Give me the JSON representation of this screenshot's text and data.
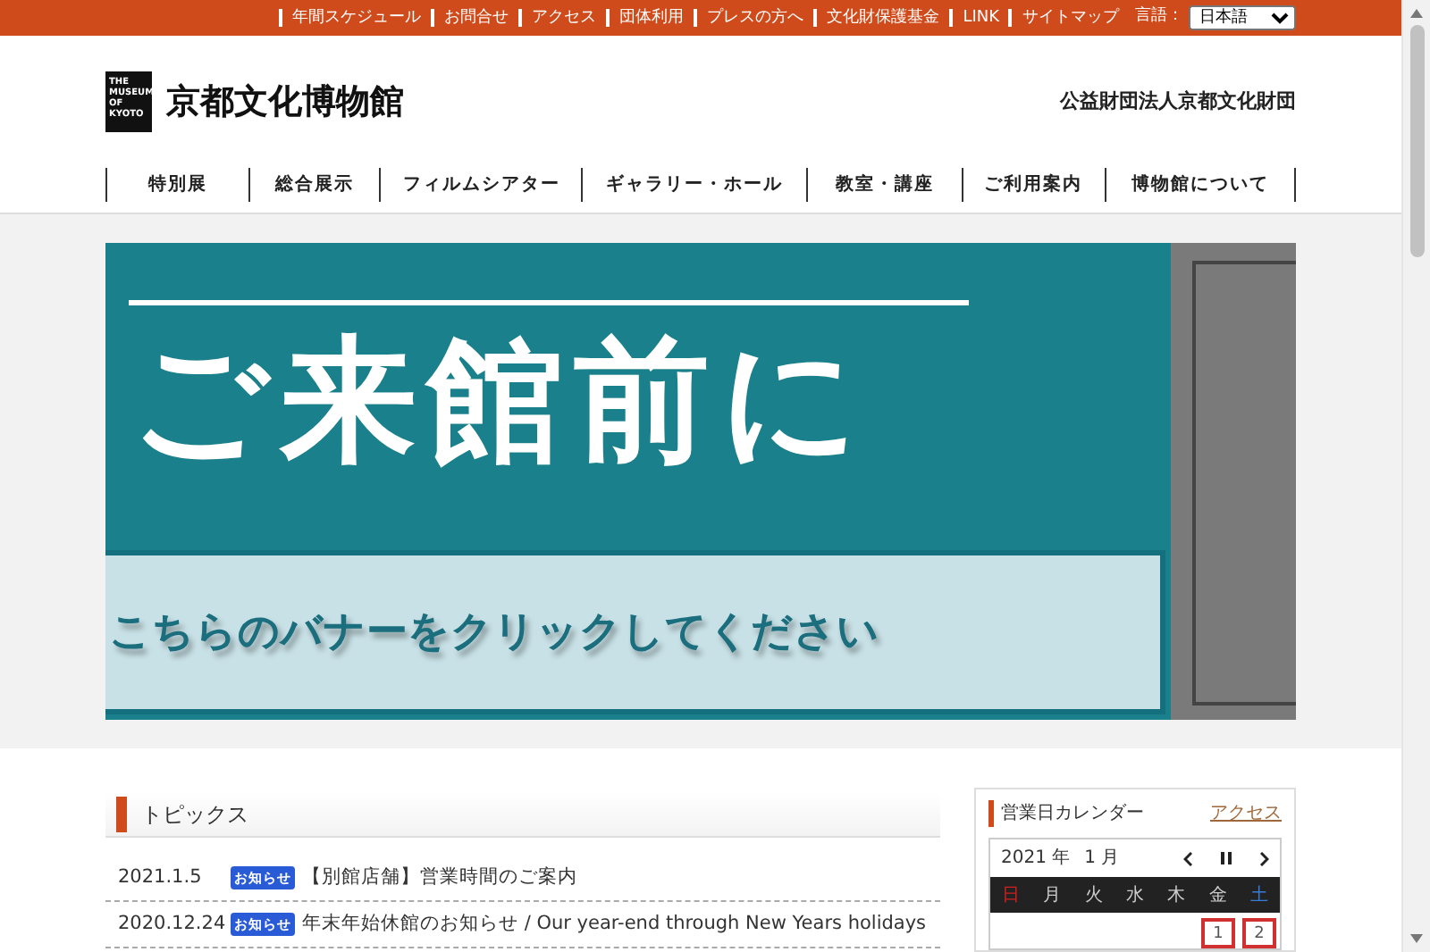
{
  "top_links": [
    "年間スケジュール",
    "お問合せ",
    "アクセス",
    "団体利用",
    "プレスの方へ",
    "文化財保護基金",
    "LINK",
    "サイトマップ"
  ],
  "language": {
    "label": "言語：",
    "value": "日本語"
  },
  "logo": {
    "mark_lines": [
      "THE",
      "MUSEUM",
      "OF KYOTO"
    ],
    "name": "京都文化博物館"
  },
  "foundation": "公益財団法人京都文化財団",
  "nav": [
    "特別展",
    "総合展示",
    "フィルムシアター",
    "ギャラリー・ホール",
    "教室・講座",
    "ご利用案内",
    "博物館について"
  ],
  "banner": {
    "headline": "ご来館前に",
    "caption": "こちらのバナーをクリックしてください"
  },
  "topics": {
    "title": "トピックス",
    "items": [
      {
        "date": "2021.1.5",
        "tag": "お知らせ",
        "text": "【別館店舗】営業時間のご案内"
      },
      {
        "date": "2020.12.24",
        "tag": "お知らせ",
        "text": "年末年始休館のお知らせ / Our year-end through New Years holidays"
      }
    ]
  },
  "calendar": {
    "title": "営業日カレンダー",
    "link": "アクセス",
    "year": "2021 年",
    "month": "1 月",
    "weekdays": [
      {
        "label": "日",
        "kind": "sun"
      },
      {
        "label": "月",
        "kind": "weekday"
      },
      {
        "label": "火",
        "kind": "weekday"
      },
      {
        "label": "水",
        "kind": "weekday"
      },
      {
        "label": "木",
        "kind": "weekday"
      },
      {
        "label": "金",
        "kind": "weekday"
      },
      {
        "label": "土",
        "kind": "sat"
      }
    ],
    "dates": [
      {
        "label": "1",
        "marked": true
      },
      {
        "label": "2",
        "marked": true
      }
    ]
  }
}
